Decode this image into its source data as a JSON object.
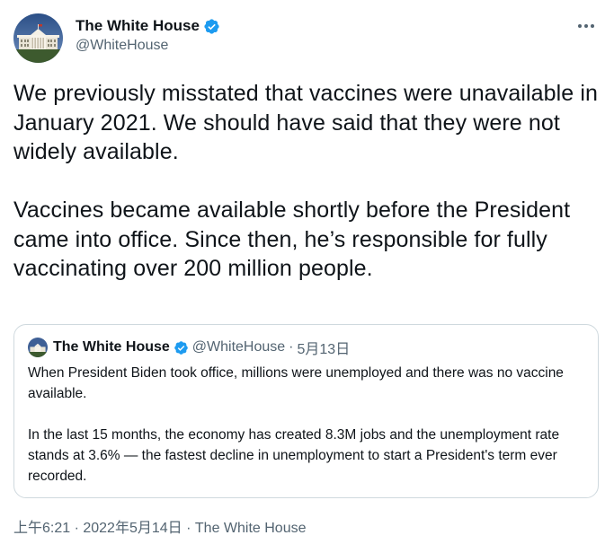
{
  "author": {
    "display_name": "The White House",
    "handle": "@WhiteHouse",
    "verified_icon": "verified-badge-icon",
    "avatar_icon": "white-house-building-icon"
  },
  "tweet": {
    "text": "We previously misstated that vaccines were unavailable in January 2021. We should have said that they were not widely available.\n\nVaccines became available shortly before the President came into office. Since then, he’s responsible for fully vaccinating over 200 million people."
  },
  "quoted_tweet": {
    "display_name": "The White House",
    "handle": "@WhiteHouse",
    "separator": "·",
    "date": "5月13日",
    "text": "When President Biden took office, millions were unemployed and there was no vaccine available.\n\nIn the last 15 months, the economy has created 8.3M jobs and the unemployment rate stands at 3.6% — the fastest decline in unemployment to start a President's term ever recorded."
  },
  "footer": {
    "timestamp": "上午6:21 · 2022年5月14日",
    "separator": "·",
    "source": "The White House"
  },
  "menu": {
    "more_icon": "more-options-icon"
  },
  "colors": {
    "verified_blue": "#1d9bf0",
    "secondary_text": "#536471",
    "border": "#cfd9de"
  }
}
